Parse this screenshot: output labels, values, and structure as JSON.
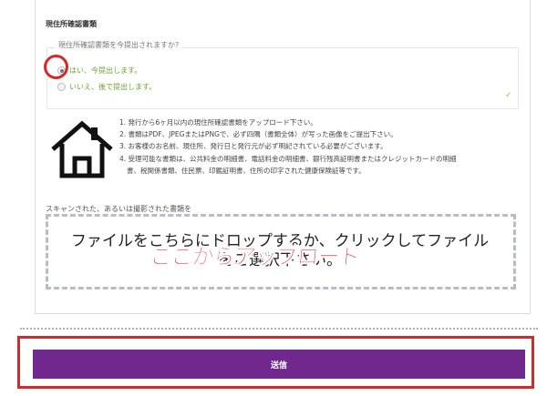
{
  "section": {
    "title": "現住所確認書類"
  },
  "question": {
    "legend": "現住所確認書類を今提出されますか?",
    "options": [
      {
        "label": "はい、今提出します。",
        "selected": true
      },
      {
        "label": "いいえ、後で提出します。",
        "selected": false
      }
    ]
  },
  "icons": {
    "house": "house-icon",
    "chevron": "chevron-down-icon"
  },
  "notes": [
    "1. 発行から6ヶ月以内の現住所確認書類をアップロード下さい。",
    "2. 書類はPDF、JPEGまたはPNGで、必ず四隅（書類全体）が写った画像をご提出下さい。",
    "3. お客様のお名前、現住所、発行日と発行元が必ず明記されている必要がございます。",
    "4. 受理可能な書類は、公共料金の明細書、電話料金の明細書、銀行残高証明書またはクレジットカードの明細",
    "書、税関係書類、住民票、印鑑証明書、住所の印字された健康保険証等です。"
  ],
  "upload": {
    "label": "スキャンされた、あるいは撮影された書類を",
    "dropzone_line1": "ファイルをこちらにドロップするか、クリックしてファイル",
    "dropzone_line2": "をご選択下さい。",
    "overlay": "ここからアップロード"
  },
  "submit": {
    "label": "送信"
  },
  "colors": {
    "accent": "#70288f",
    "highlight": "#d62828",
    "radio_label": "#6ca533"
  }
}
